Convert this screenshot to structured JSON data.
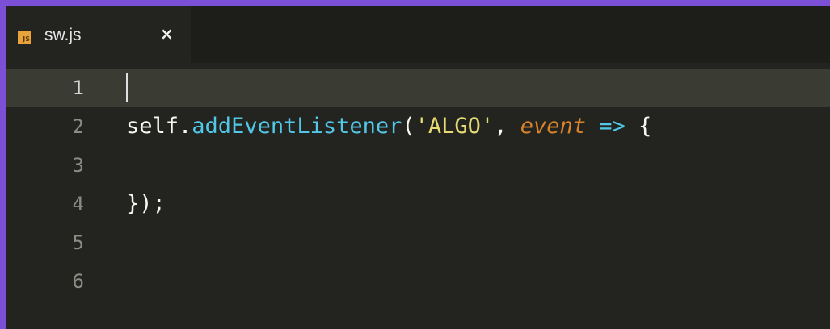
{
  "tab": {
    "icon": "js-file-icon",
    "icon_text": "JS",
    "filename": "sw.js",
    "close_glyph": "×"
  },
  "editor": {
    "lines": [
      {
        "number": "1",
        "text": ""
      },
      {
        "number": "2",
        "tokens": [
          "self",
          ".",
          "addEventListener",
          "(",
          "'ALGO'",
          ", ",
          "event",
          " ",
          "=>",
          " {"
        ]
      },
      {
        "number": "3",
        "text": ""
      },
      {
        "number": "4",
        "text": "});"
      },
      {
        "number": "5",
        "text": ""
      },
      {
        "number": "6",
        "text": ""
      }
    ],
    "current_line": "1"
  },
  "colors": {
    "accent_border": "#7b4fd6",
    "editor_bg": "#23241f",
    "function": "#52c7e8",
    "string": "#e6db74",
    "parameter": "#d8832b",
    "js_icon": "#e8a33b"
  }
}
